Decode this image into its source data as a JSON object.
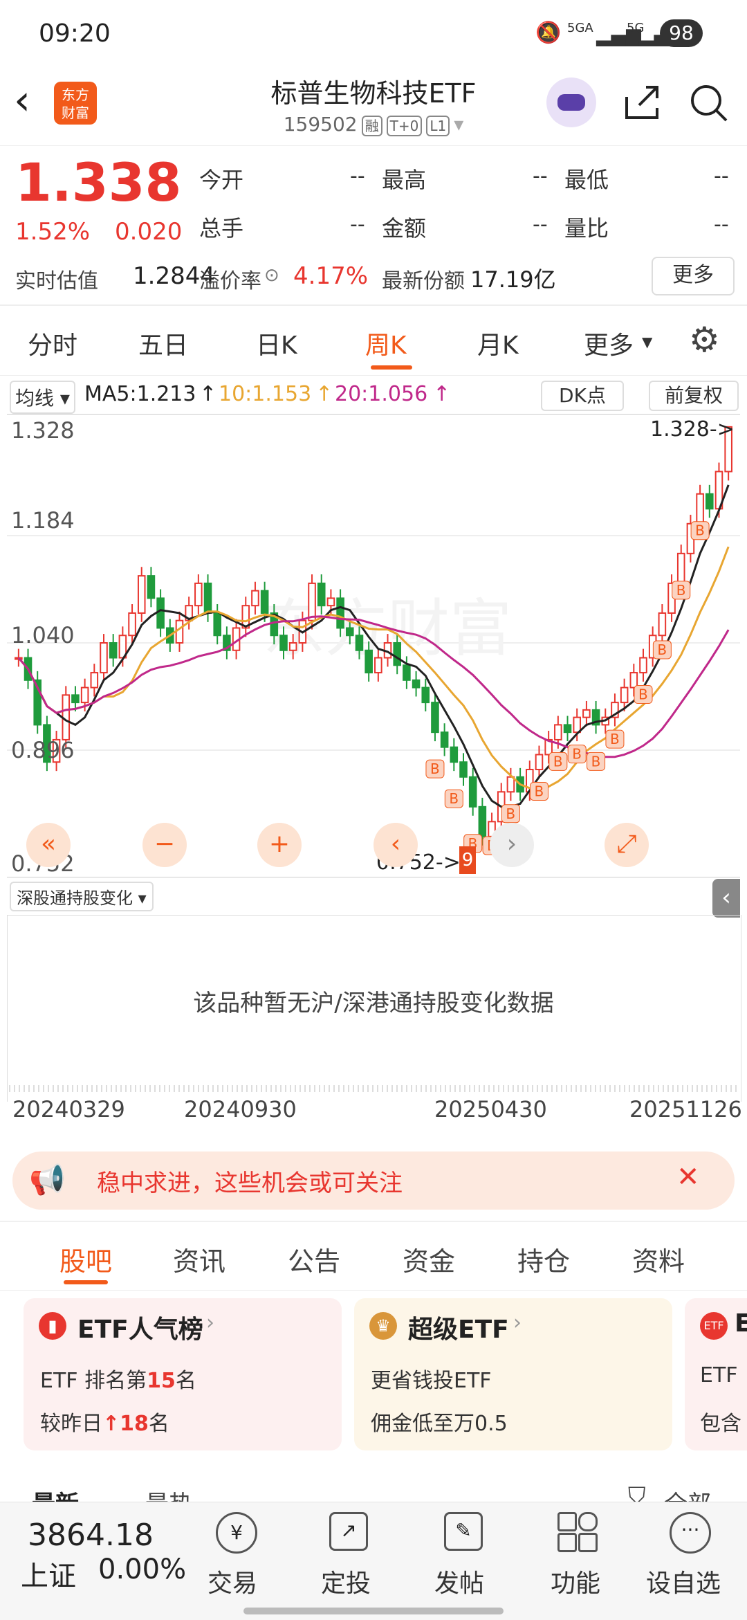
{
  "status": {
    "time": "09:20",
    "net1": "5GA",
    "net2": "5G",
    "battery": "98"
  },
  "header": {
    "logo_line1": "东方",
    "logo_line2": "财富",
    "title": "标普生物科技ETF",
    "code": "159502",
    "tag1": "融",
    "tag2": "T+0",
    "tag3": "L1"
  },
  "quote": {
    "price": "1.338",
    "change_pct": "1.52%",
    "change_val": "0.020",
    "open_label": "今开",
    "open": "--",
    "high_label": "最高",
    "high": "--",
    "low_label": "最低",
    "low": "--",
    "vol_label": "总手",
    "vol": "--",
    "amt_label": "金额",
    "amt": "--",
    "ratio_label": "量比",
    "ratio": "--",
    "est_label": "实时估值",
    "est": "1.2844",
    "premium_label": "溢价率",
    "premium": "4.17%",
    "share_label": "最新份额",
    "share": "17.19亿",
    "more": "更多"
  },
  "tabs": [
    "分时",
    "五日",
    "日K",
    "周K",
    "月K",
    "更多"
  ],
  "active_tab": "周K",
  "indicators": {
    "ma_select": "均线",
    "ma5": "MA5:1.213",
    "ma10": "10:1.153",
    "ma20": "20:1.056",
    "dk": "DK点",
    "adjust": "前复权"
  },
  "chart_data": {
    "type": "candlestick",
    "title": "",
    "y_ticks": [
      "1.328",
      "1.184",
      "1.040",
      "0.896",
      "0.752"
    ],
    "ylim": [
      0.752,
      1.328
    ],
    "x_ticks": [
      "20240329",
      "20240930",
      "20250430",
      "20251126"
    ],
    "max_label": "1.328->",
    "min_label": "0.752->",
    "min_marker": "9",
    "ma": {
      "MA5": 1.213,
      "MA10": 1.153,
      "MA20": 1.056
    },
    "series_colors": {
      "up": "#e8362f",
      "down": "#1f9b3c",
      "ma5": "#222222",
      "ma10": "#e8a631",
      "ma20": "#c0288a"
    },
    "closes": [
      1.02,
      0.99,
      0.93,
      0.88,
      0.91,
      0.97,
      0.96,
      0.98,
      1.0,
      1.04,
      1.02,
      1.05,
      1.08,
      1.13,
      1.1,
      1.06,
      1.04,
      1.07,
      1.09,
      1.12,
      1.08,
      1.05,
      1.03,
      1.06,
      1.09,
      1.11,
      1.08,
      1.05,
      1.03,
      1.04,
      1.07,
      1.12,
      1.09,
      1.1,
      1.06,
      1.05,
      1.03,
      1.0,
      1.02,
      1.04,
      1.01,
      0.99,
      0.98,
      0.96,
      0.92,
      0.9,
      0.88,
      0.86,
      0.82,
      0.78,
      0.8,
      0.84,
      0.86,
      0.84,
      0.87,
      0.89,
      0.91,
      0.93,
      0.92,
      0.94,
      0.95,
      0.93,
      0.94,
      0.96,
      0.98,
      1.0,
      1.02,
      1.05,
      1.08,
      1.12,
      1.16,
      1.2,
      1.24,
      1.22,
      1.27,
      1.33
    ],
    "signals_b": 14,
    "watermark": "东方财富"
  },
  "hk_section": {
    "select": "深股通持股变化",
    "empty_text": "该品种暂无沪/深港通持股变化数据"
  },
  "banner": {
    "text": "稳中求进，这些机会或可关注"
  },
  "subtabs": [
    "股吧",
    "资讯",
    "公告",
    "资金",
    "持仓",
    "资料"
  ],
  "active_subtab": "股吧",
  "cards": [
    {
      "title": "ETF人气榜",
      "line1_pre": "ETF 排名第",
      "line1_num": "15",
      "line1_post": "名",
      "line2_pre": "较昨日",
      "line2_num": "18",
      "line2_post": "名"
    },
    {
      "title": "超级ETF",
      "line1": "更省钱投ETF",
      "line2": "佣金低至万0.5"
    },
    {
      "title": "E",
      "line1": "ETF",
      "line2": "包含"
    }
  ],
  "feed": {
    "sort1": "最新",
    "sort2": "最热",
    "filter": "全部"
  },
  "bottom": {
    "index_value": "3864.18",
    "index_name": "上证",
    "index_change": "0.00%",
    "nav": [
      "交易",
      "定投",
      "发帖",
      "功能",
      "设自选"
    ]
  }
}
